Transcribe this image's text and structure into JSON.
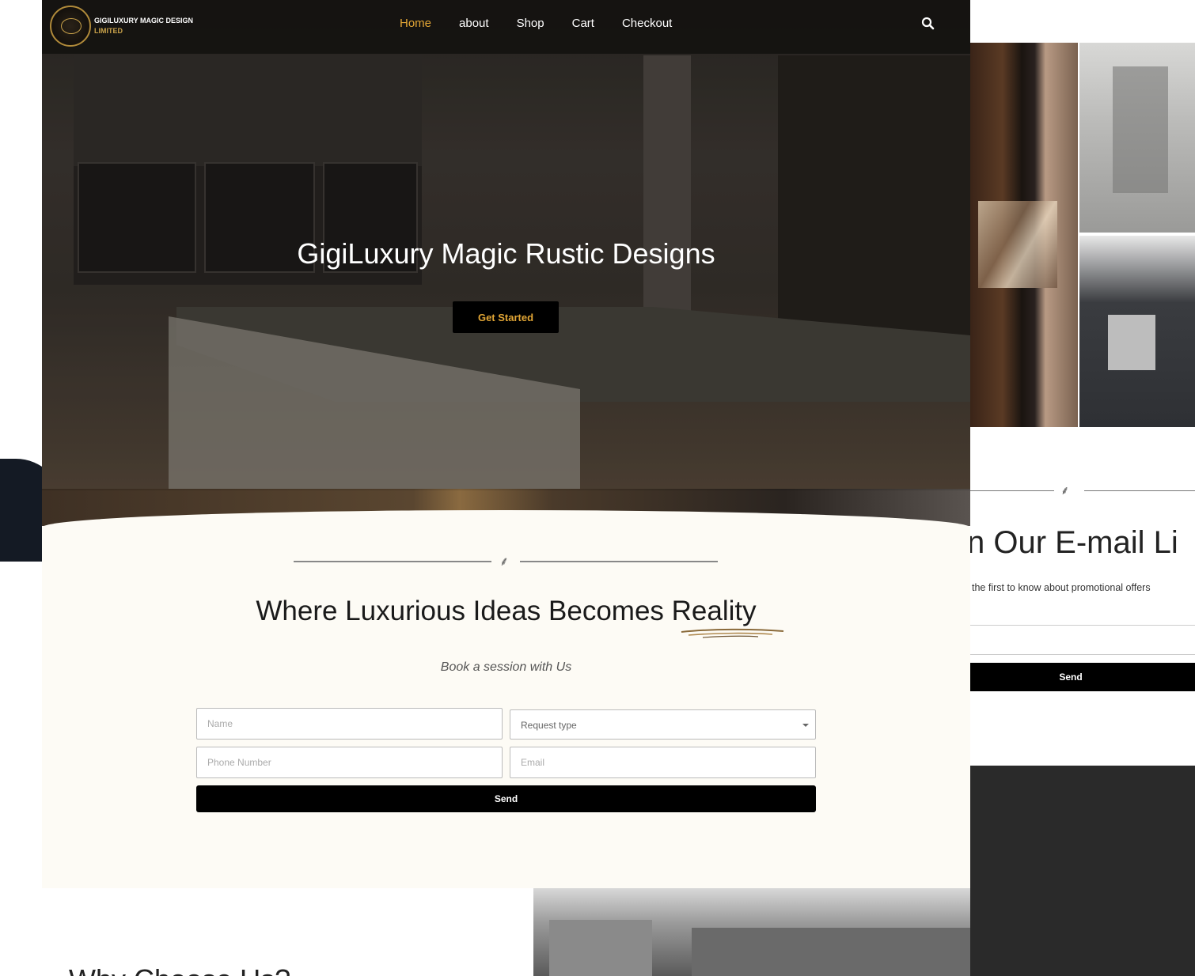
{
  "nav": {
    "brand_line1": "GIGILUXURY MAGIC DESIGN",
    "brand_line2": "LIMITED",
    "items": [
      {
        "label": "Home",
        "active": true
      },
      {
        "label": "about",
        "active": false
      },
      {
        "label": "Shop",
        "active": false
      },
      {
        "label": "Cart",
        "active": false
      },
      {
        "label": "Checkout",
        "active": false
      }
    ],
    "search_icon": "search-icon"
  },
  "hero": {
    "title": "GigiLuxury Magic Rustic Designs",
    "cta": "Get Started"
  },
  "booking": {
    "divider_icon": "leaf-ornament-icon",
    "title": "Where Luxurious Ideas Becomes Reality",
    "subtitle": "Book a session with Us",
    "fields": {
      "name_placeholder": "Name",
      "request_type": "Request type",
      "phone_placeholder": "Phone Number",
      "email_placeholder": "Email"
    },
    "send": "Send"
  },
  "why": {
    "title": "Why Choose Us?"
  },
  "side_mockup": {
    "divider_icon": "leaf-ornament-icon",
    "title": "n Our E-mail Li",
    "subtitle": "the first to know about promotional offers",
    "send": "Send"
  },
  "colors": {
    "accent": "#e2a635",
    "booking_bg": "#fdfbf5",
    "nav_bg": "#141210",
    "button_bg": "#000000"
  }
}
